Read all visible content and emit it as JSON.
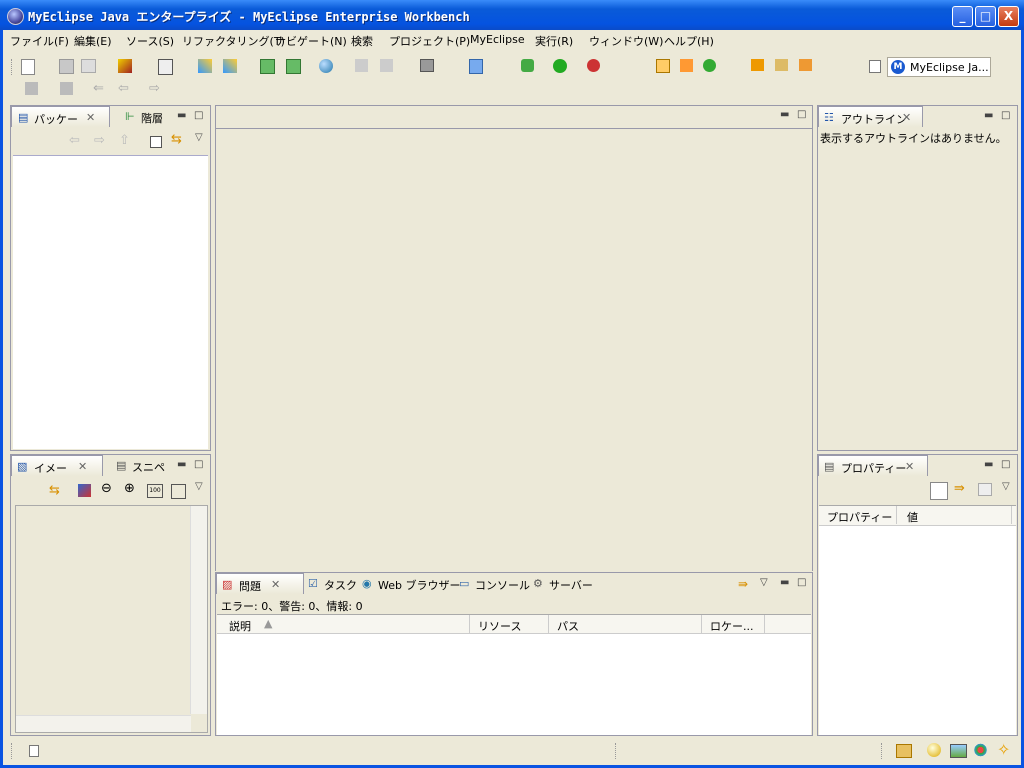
{
  "window": {
    "title": "MyEclipse Java エンタープライズ - MyEclipse Enterprise Workbench",
    "minimize": "_",
    "maximize": "□",
    "close": "X"
  },
  "menu": [
    "ファイル(F)",
    "編集(E)",
    "ソース(S)",
    "リファクタリング(T)",
    "ナビゲート(N)",
    "検索",
    "プロジェクト(P)",
    "MyEclipse",
    "実行(R)",
    "ウィンドウ(W)",
    "ヘルプ(H)"
  ],
  "perspective": {
    "label": "MyEclipse Ja..."
  },
  "package_view": {
    "tab1": "パッケー",
    "tab2": "階層"
  },
  "image_view": {
    "tab1": "イメー",
    "tab2": "スニペ"
  },
  "outline_view": {
    "tab": "アウトライン",
    "message": "表示するアウトラインはありません。"
  },
  "properties_view": {
    "tab": "プロパティー",
    "columns": [
      "プロパティー",
      "値"
    ]
  },
  "problems_view": {
    "tabs": [
      "問題",
      "タスク",
      "Web ブラウザー",
      "コンソール",
      "サーバー"
    ],
    "summary": "エラー: 0、警告: 0、情報: 0",
    "columns": [
      "説明",
      "リソース",
      "パス",
      "ロケー..."
    ]
  },
  "colors": {
    "accent": "#0a54e2",
    "chrome": "#ece9d8",
    "view_border": "#99a"
  },
  "icons": [
    "new-icon",
    "save-icon",
    "print-icon",
    "run-icon",
    "debug-icon",
    "search-icon",
    "globe-icon",
    "back-icon",
    "forward-icon"
  ]
}
